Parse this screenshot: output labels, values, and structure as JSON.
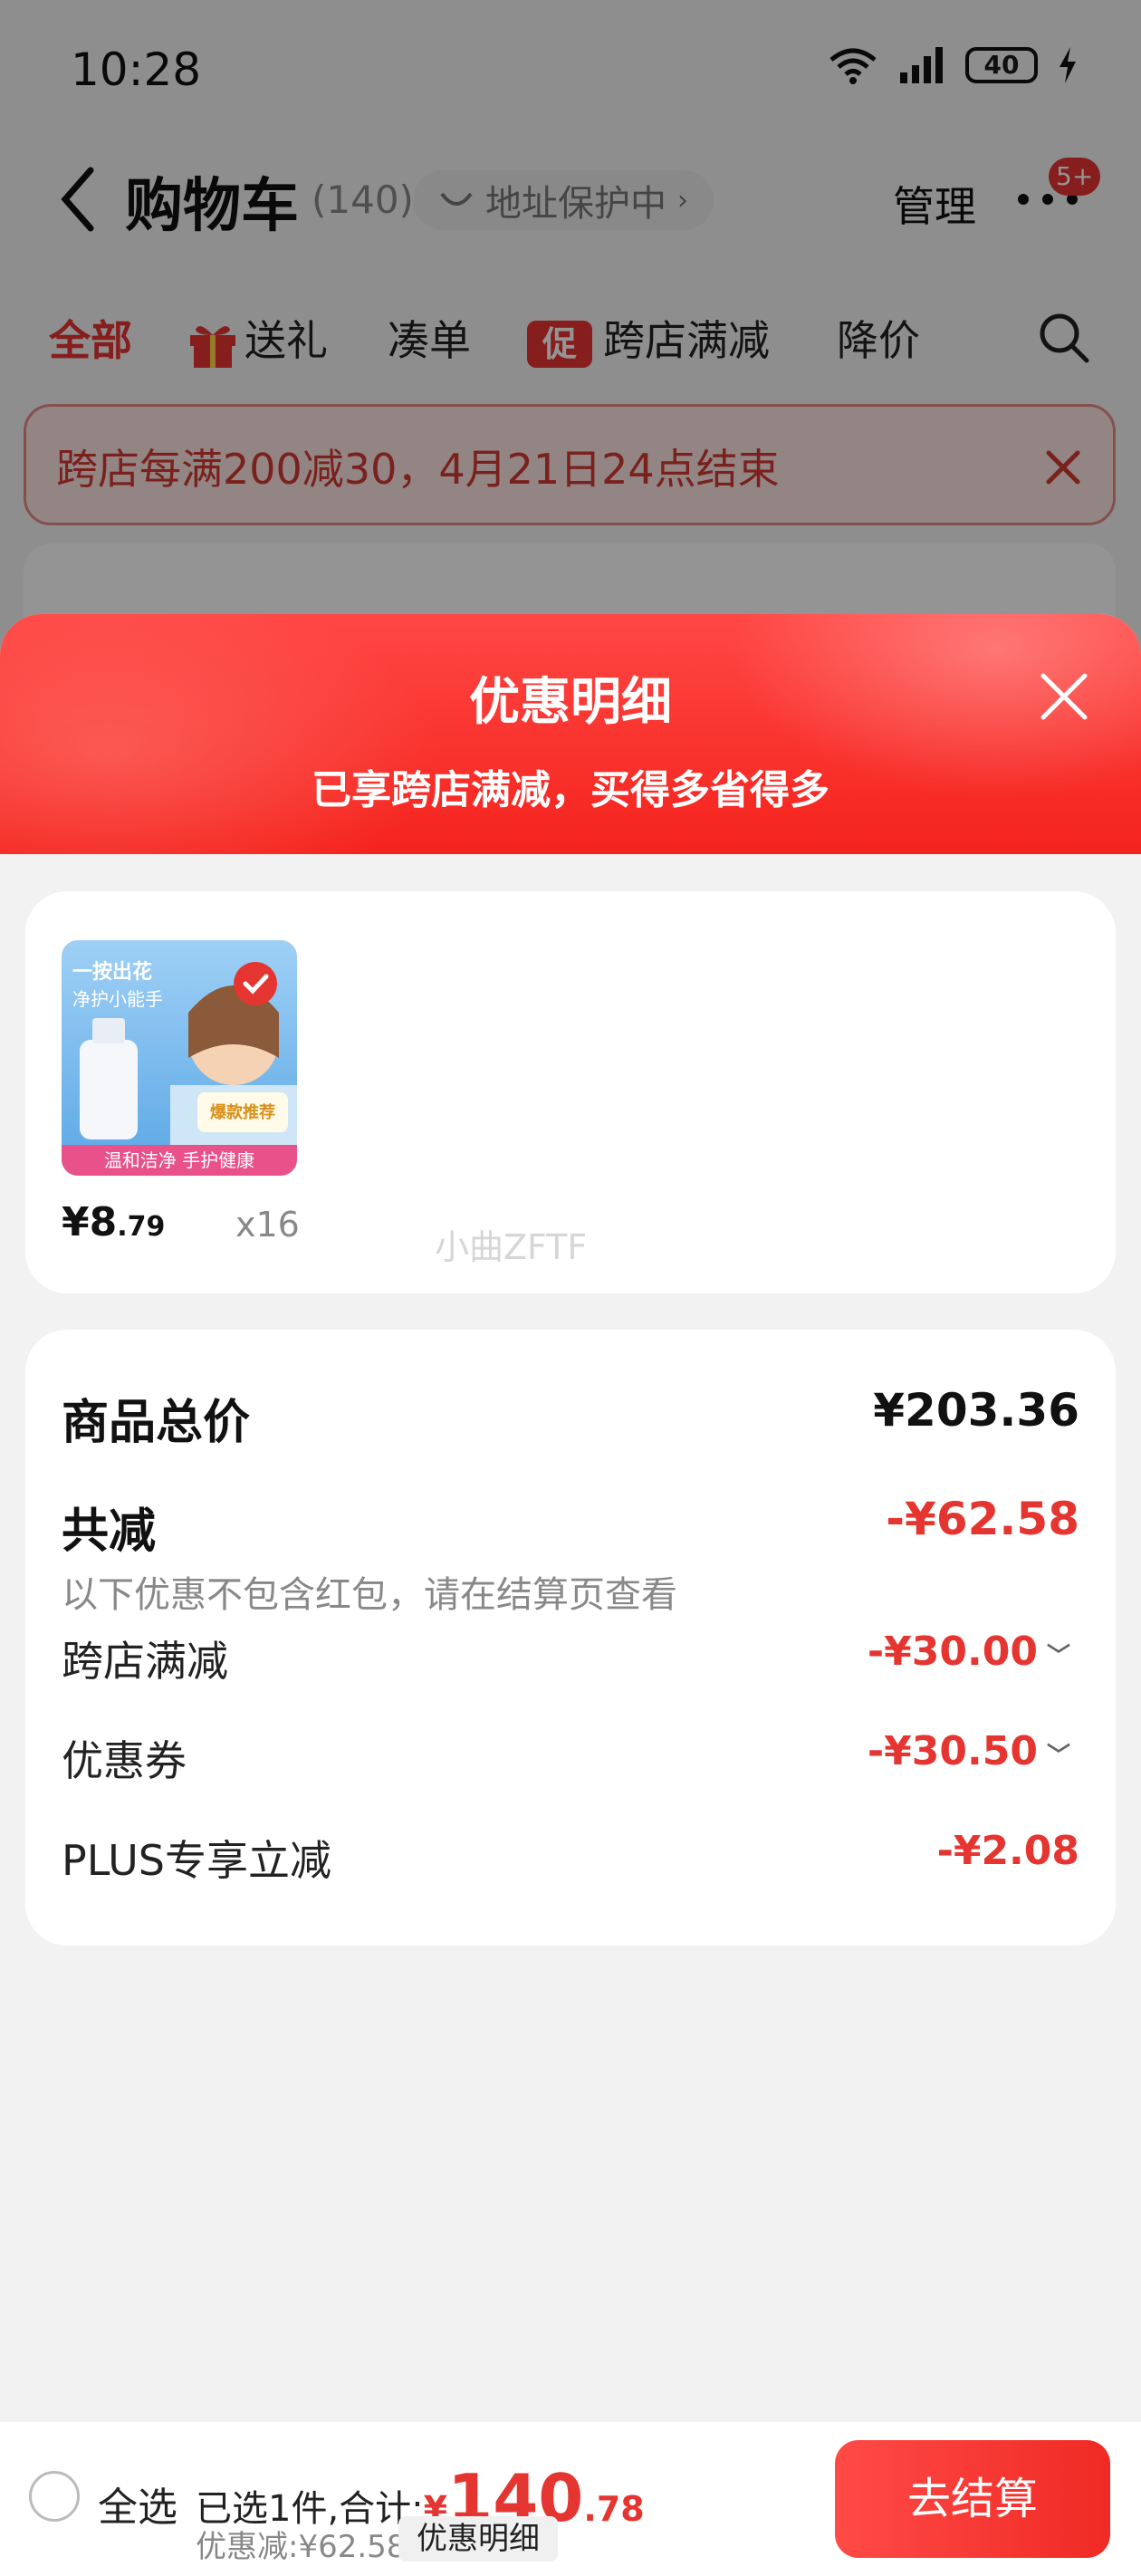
{
  "status_bar": {
    "time": "10:28",
    "battery": "40"
  },
  "header": {
    "title": "购物车",
    "count": "(140)",
    "address_chip": "地址保护中",
    "manage": "管理",
    "badge": "5+"
  },
  "filters": {
    "all": "全部",
    "gift": "送礼",
    "combine": "凑单",
    "promo_tag": "促",
    "cross_store": "跨店满减",
    "price_drop": "降价"
  },
  "notice": {
    "text": "跨店每满200减30，4月21日24点结束"
  },
  "sheet": {
    "title": "优惠明细",
    "subtitle": "已享跨店满减，买得多省得多"
  },
  "product": {
    "price_int": "¥8",
    "price_dec": ".79",
    "qty": "x16",
    "image_text": {
      "line1": "一按出花",
      "line2": "净护小能手",
      "hot": "爆款推荐",
      "bottom": "温和洁净 手护健康"
    }
  },
  "watermark": "小曲ZFTF",
  "summary": {
    "total_label": "商品总价",
    "total_value": "¥203.36",
    "save_label": "共减",
    "save_value": "-¥62.58",
    "note": "以下优惠不包含红包，请在结算页查看",
    "items": [
      {
        "label": "跨店满减",
        "value": "-¥30.00"
      },
      {
        "label": "优惠券",
        "value": "-¥30.50"
      },
      {
        "label": "PLUS专享立减",
        "value": "-¥2.08"
      }
    ]
  },
  "bottom_bar": {
    "select_all": "全选",
    "selected_text": "已选1件,合计:",
    "currency": "¥",
    "amount_int": "140",
    "amount_dec": ".78",
    "discount_text": "优惠减:¥62.58",
    "detail_chip": "优惠明细",
    "checkout": "去结算"
  },
  "colors": {
    "accent": "#e53531",
    "header_red": "#f5231d"
  }
}
